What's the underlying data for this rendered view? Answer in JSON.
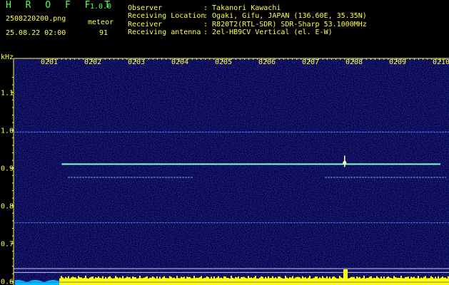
{
  "header": {
    "app_name": "H R O F F T",
    "version": "1.0.0",
    "filename": "2508220200.png",
    "datetime": "25.08.22 02:00",
    "mode_label": "meteor",
    "count": "91",
    "fields": [
      {
        "label": "Observer",
        "value": ": Takanori Kawachi"
      },
      {
        "label": "Receiving Location",
        "value": ": Ogaki, Gifu, JAPAN (136.60E, 35.35N)"
      },
      {
        "label": "Receiver",
        "value": ": R820T2(RTL-SDR) SDR-Sharp 53.1000MHz"
      },
      {
        "label": "Receiving antenna",
        "value": ": 2el-HB9CV Vertical (el. E-W)"
      }
    ]
  },
  "chart_data": {
    "type": "heatmap",
    "ylabel": "kHz",
    "x_ticks": [
      "0201",
      "0202",
      "0203",
      "0204",
      "0205",
      "0206",
      "0207",
      "0208",
      "0209",
      "0210"
    ],
    "y_ticks": [
      "1.1",
      "1.0",
      "0.9",
      "0.8",
      "0.7",
      "0.6"
    ],
    "ylim": [
      0.59,
      1.19
    ],
    "features": [
      {
        "kind": "carrier",
        "freq_khz": 0.91,
        "from": "0201.3",
        "to": "0210.0",
        "color": "#7fffd4"
      },
      {
        "kind": "faint-line",
        "freq_khz": 0.995,
        "color": "#5a78ff"
      },
      {
        "kind": "faint-line",
        "freq_khz": 0.755,
        "color": "#5a78ff"
      },
      {
        "kind": "faint-line",
        "freq_khz": 0.875,
        "color": "#8fa8ff"
      },
      {
        "kind": "faint-line",
        "freq_khz": 0.875,
        "color": "#8fa8ff"
      },
      {
        "kind": "meteor-ping",
        "time": "0207.8",
        "freq_khz": 0.91
      }
    ],
    "colors": {
      "background": "#000033",
      "noise": "#1a1ab0",
      "axis": "#ffff55",
      "carrier": "#7fffd4",
      "amplitude": "#ffff00",
      "amplitude_low": "#00c0ff"
    }
  }
}
